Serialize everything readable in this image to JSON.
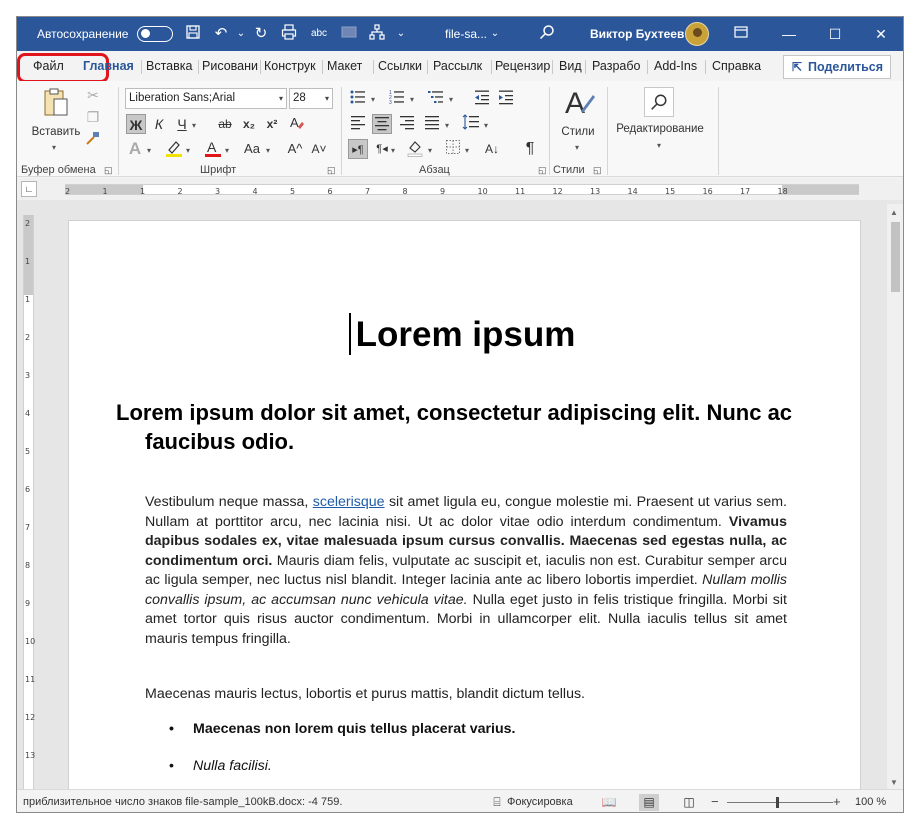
{
  "titlebar": {
    "autosave_label": "Автосохранение",
    "doc_title": "file-sa...",
    "user_name": "Виктор Бухтеев",
    "icons": [
      "save-icon",
      "undo-icon",
      "redo-icon",
      "print-icon",
      "spelling-icon",
      "diagram-icon",
      "search-icon",
      "ribbon-display-icon",
      "minimize-icon",
      "maximize-icon",
      "close-icon"
    ],
    "spelling_glyph": "abc"
  },
  "tabs": {
    "file": "Файл",
    "items": [
      "Главная",
      "Вставка",
      "Рисовани",
      "Конструк",
      "Макет",
      "Ссылки",
      "Рассылк",
      "Рецензир",
      "Вид",
      "Разрабо",
      "Add-Ins",
      "Справка"
    ],
    "share": "Поделиться"
  },
  "ribbon": {
    "clipboard": {
      "paste": "Вставить",
      "label": "Буфер обмена"
    },
    "font": {
      "name": "Liberation Sans;Arial",
      "size": "28",
      "bold": "Ж",
      "italic": "К",
      "underline": "Ч",
      "strike": "ab",
      "subscript": "x₂",
      "superscript": "x²",
      "change_case": "Aa",
      "grow": "A^",
      "shrink": "A˅",
      "label": "Шрифт"
    },
    "paragraph": {
      "label": "Абзац"
    },
    "styles": {
      "button": "Стили",
      "label": "Стили"
    },
    "editing": {
      "button": "Редактирование"
    }
  },
  "ruler": {
    "ticks": [
      "2",
      "1",
      "1",
      "2",
      "3",
      "4",
      "5",
      "6",
      "7",
      "8",
      "9",
      "10",
      "11",
      "12",
      "13",
      "14",
      "15",
      "16",
      "17",
      "18"
    ],
    "vticks": [
      "2",
      "1",
      "1",
      "2",
      "3",
      "4",
      "5",
      "6",
      "7",
      "8",
      "9",
      "10",
      "11",
      "12",
      "13"
    ]
  },
  "document": {
    "title": "Lorem ipsum",
    "heading": "Lorem ipsum dolor sit amet, consectetur adipiscing elit. Nunc ac faucibus odio.",
    "para1": {
      "t1": "Vestibulum neque massa, ",
      "link": "scelerisque",
      "t2": " sit amet ligula eu, congue molestie mi. Praesent ut varius sem. Nullam at porttitor arcu, nec lacinia nisi. Ut ac dolor vitae odio interdum condimentum. ",
      "bold": "Vivamus dapibus sodales ex, vitae malesuada ipsum cursus convallis. Maecenas sed egestas nulla, ac condimentum orci.",
      "t3": " Mauris diam felis, vulputate ac suscipit et, iaculis non est. Curabitur semper arcu ac ligula semper, nec luctus nisl blandit. Integer lacinia ante ac libero lobortis imperdiet. ",
      "italic": "Nullam mollis convallis ipsum, ac accumsan nunc vehicula vitae.",
      "t4": " Nulla eget justo in felis tristique fringilla. Morbi sit amet tortor quis risus auctor condimentum. Morbi in ullamcorper elit. Nulla iaculis tellus sit amet mauris tempus fringilla."
    },
    "para2": "Maecenas mauris lectus, lobortis et purus mattis, blandit dictum tellus.",
    "bullets": [
      {
        "text": "Maecenas non lorem quis tellus placerat varius.",
        "style": "bold"
      },
      {
        "text": "Nulla facilisi.",
        "style": "italic"
      }
    ]
  },
  "statusbar": {
    "word_count": "приблизительное число знаков file-sample_100kB.docx: -4 759.",
    "focus": "Фокусировка",
    "zoom": "100 %",
    "zoom_level": 100
  },
  "colors": {
    "accent": "#2b579a",
    "highlight_callout": "#e0141b",
    "link": "#1f5ba8"
  }
}
